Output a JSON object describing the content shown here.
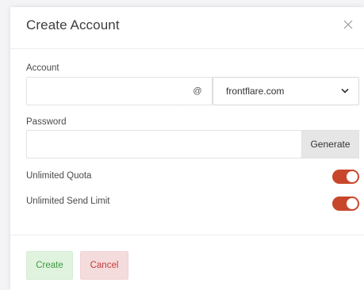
{
  "modal": {
    "title": "Create Account",
    "close_icon": "close-icon"
  },
  "form": {
    "account": {
      "label": "Account",
      "value": "",
      "placeholder": "",
      "at_symbol": "@",
      "domain_selected": "frontflare.com"
    },
    "password": {
      "label": "Password",
      "value": "",
      "placeholder": "",
      "generate_label": "Generate"
    },
    "toggles": [
      {
        "label": "Unlimited Quota",
        "on": true
      },
      {
        "label": "Unlimited Send Limit",
        "on": true
      }
    ]
  },
  "footer": {
    "create_label": "Create",
    "cancel_label": "Cancel"
  },
  "colors": {
    "toggle_on": "#c8472b",
    "create_bg": "#dff3df",
    "create_text": "#3f9a3f",
    "cancel_bg": "#f5dcdc",
    "cancel_text": "#c23b3b"
  }
}
